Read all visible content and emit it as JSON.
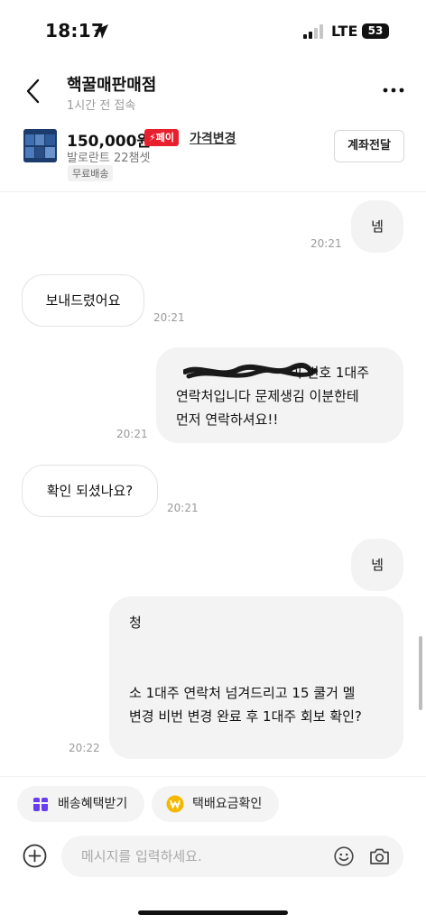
{
  "status_bar": {
    "time": "18:17",
    "network": "LTE",
    "battery": "53"
  },
  "header": {
    "title": "핵꿀매판매점",
    "subtitle": "1시간 전 접속"
  },
  "product": {
    "price": "150,000원",
    "pay_badge": "페이",
    "price_change": "가격변경",
    "name": "발로란트 22챔셋",
    "shipping": "무료배송",
    "transfer_button": "계좌전달"
  },
  "messages": [
    {
      "direction": "out",
      "lines": [
        "넴"
      ],
      "time": "20:21"
    },
    {
      "direction": "in",
      "lines": [
        "보내드렸어요"
      ],
      "time": "20:21"
    },
    {
      "direction": "out",
      "lines": [
        "이 번호 1대주",
        "연락처입니다 문제생김 이분한테",
        "먼저 연락하셔요!!"
      ],
      "time": "20:21"
    },
    {
      "direction": "in",
      "lines": [
        "확인 되셨나요?"
      ],
      "time": "20:21"
    },
    {
      "direction": "out",
      "lines": [
        "넴"
      ],
      "time": ""
    },
    {
      "direction": "out",
      "lines": [
        "청",
        "소 1대주 연락처 넘겨드리고 15 쿨거 멜",
        "변경 비번 변경 완료 후 1대주 회보 확인?"
      ],
      "time": "20:22"
    }
  ],
  "quick_actions": [
    {
      "label": "배송혜택받기",
      "icon": "gift-box-icon",
      "color": "#6b3df0"
    },
    {
      "label": "택배요금확인",
      "icon": "won-coin-icon",
      "color": "#f5b800"
    }
  ],
  "input": {
    "placeholder": "메시지를 입력하세요."
  },
  "colors": {
    "pay_badge": "#e8202e",
    "bubble_out": "#f3f3f3",
    "bubble_in_border": "#e3e3e3"
  }
}
